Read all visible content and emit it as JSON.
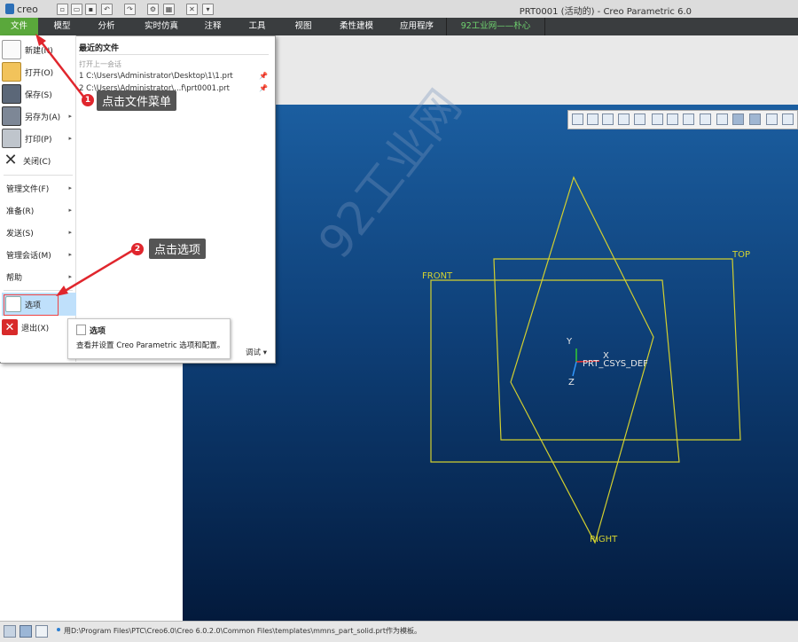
{
  "app": {
    "logo_text": "creo",
    "window_title": "PRT0001 (活动的) - Creo Parametric 6.0"
  },
  "tabs": [
    {
      "label": "文件"
    },
    {
      "label": "模型"
    },
    {
      "label": "分析"
    },
    {
      "label": "实时仿真"
    },
    {
      "label": "注释"
    },
    {
      "label": "工具"
    },
    {
      "label": "视图"
    },
    {
      "label": "柔性建模"
    },
    {
      "label": "应用程序"
    },
    {
      "label": "92工业网——朴心"
    }
  ],
  "file_menu": {
    "items": [
      {
        "label": "新建(N)",
        "icon": "new-file-icon"
      },
      {
        "label": "打开(O)",
        "icon": "folder-open-icon"
      },
      {
        "label": "保存(S)",
        "icon": "save-icon"
      },
      {
        "label": "另存为(A)",
        "icon": "save-as-icon"
      },
      {
        "label": "打印(P)",
        "icon": "print-icon"
      },
      {
        "label": "关闭(C)",
        "icon": "close-icon"
      }
    ],
    "sub_items": [
      {
        "label": "管理文件(F)"
      },
      {
        "label": "准备(R)"
      },
      {
        "label": "发送(S)"
      },
      {
        "label": "管理会话(M)"
      },
      {
        "label": "帮助"
      }
    ],
    "options_label": "选项",
    "exit_label": "退出(X)",
    "recent_title": "最近的文件",
    "open_last_session": "打开上一会话",
    "recent_files": [
      "1 C:\\Users\\Administrator\\Desktop\\1\\1.prt",
      "2 C:\\Users\\Administrator\\...f\\prt0001.prt"
    ],
    "debug_label": "调试"
  },
  "tooltip": {
    "title": "选项",
    "text": "查看并设置 Creo Parametric 选项和配置。"
  },
  "callouts": [
    {
      "number": "1",
      "text": "点击文件菜单"
    },
    {
      "number": "2",
      "text": "点击选项"
    }
  ],
  "model": {
    "planes": [
      "FRONT",
      "TOP",
      "RIGHT"
    ],
    "csys": "PRT_CSYS_DEF",
    "axes": [
      "X",
      "Y",
      "Z"
    ]
  },
  "watermark": "92工业网",
  "status": {
    "message": "用D:\\Program Files\\PTC\\Creo6.0\\Creo 6.0.2.0\\Common Files\\templates\\mmns_part_solid.prt作为模板。"
  }
}
